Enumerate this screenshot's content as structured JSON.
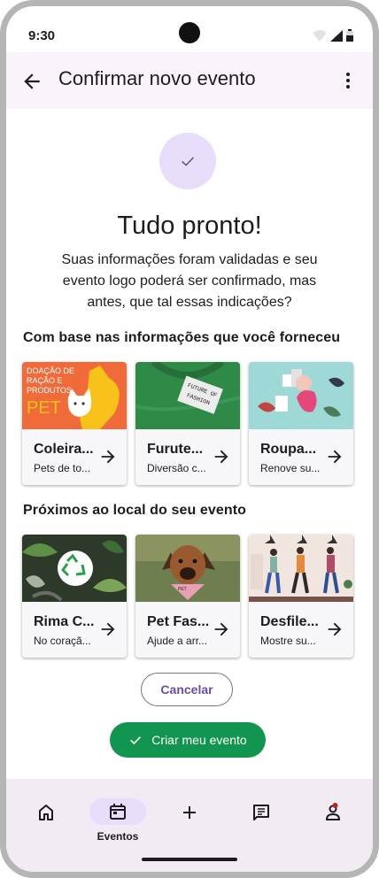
{
  "status": {
    "time": "9:30"
  },
  "appbar": {
    "title": "Confirmar novo evento"
  },
  "confirmation": {
    "headline": "Tudo pronto!",
    "description": "Suas informações foram validadas e seu evento logo poderá ser confirmado, mas antes, que tal essas indicações?"
  },
  "section1": {
    "title": "Com base nas informações que você forneceu",
    "cards": [
      {
        "title": "Coleira...",
        "subtitle": "Pets de to...",
        "image_text": "DOAÇÃO DE RAÇÃO E PRODUTOS PET"
      },
      {
        "title": "Furute...",
        "subtitle": "Diversão c...",
        "image_text": "FUTURE OF FASHION"
      },
      {
        "title": "Roupa...",
        "subtitle": "Renove su..."
      }
    ]
  },
  "section2": {
    "title": "Próximos ao local do seu evento",
    "cards": [
      {
        "title": "Rima C...",
        "subtitle": "No coraçã..."
      },
      {
        "title": "Pet Fas...",
        "subtitle": "Ajude a arr..."
      },
      {
        "title": "Desfile...",
        "subtitle": "Mostre su..."
      }
    ]
  },
  "buttons": {
    "cancel": "Cancelar",
    "create": "Criar meu evento"
  },
  "navbar": {
    "events_label": "Eventos"
  },
  "colors": {
    "accent": "#6750a4",
    "primary_green": "#12964f",
    "appbar_bg": "#fbf3fb",
    "nav_bg": "#f2ebf4",
    "indicator": "#e8ddfb"
  },
  "icons": [
    "arrow-back-icon",
    "more-vert-icon",
    "check-icon",
    "arrow-forward-icon",
    "home-icon",
    "calendar-icon",
    "add-icon",
    "chat-icon",
    "person-icon"
  ]
}
